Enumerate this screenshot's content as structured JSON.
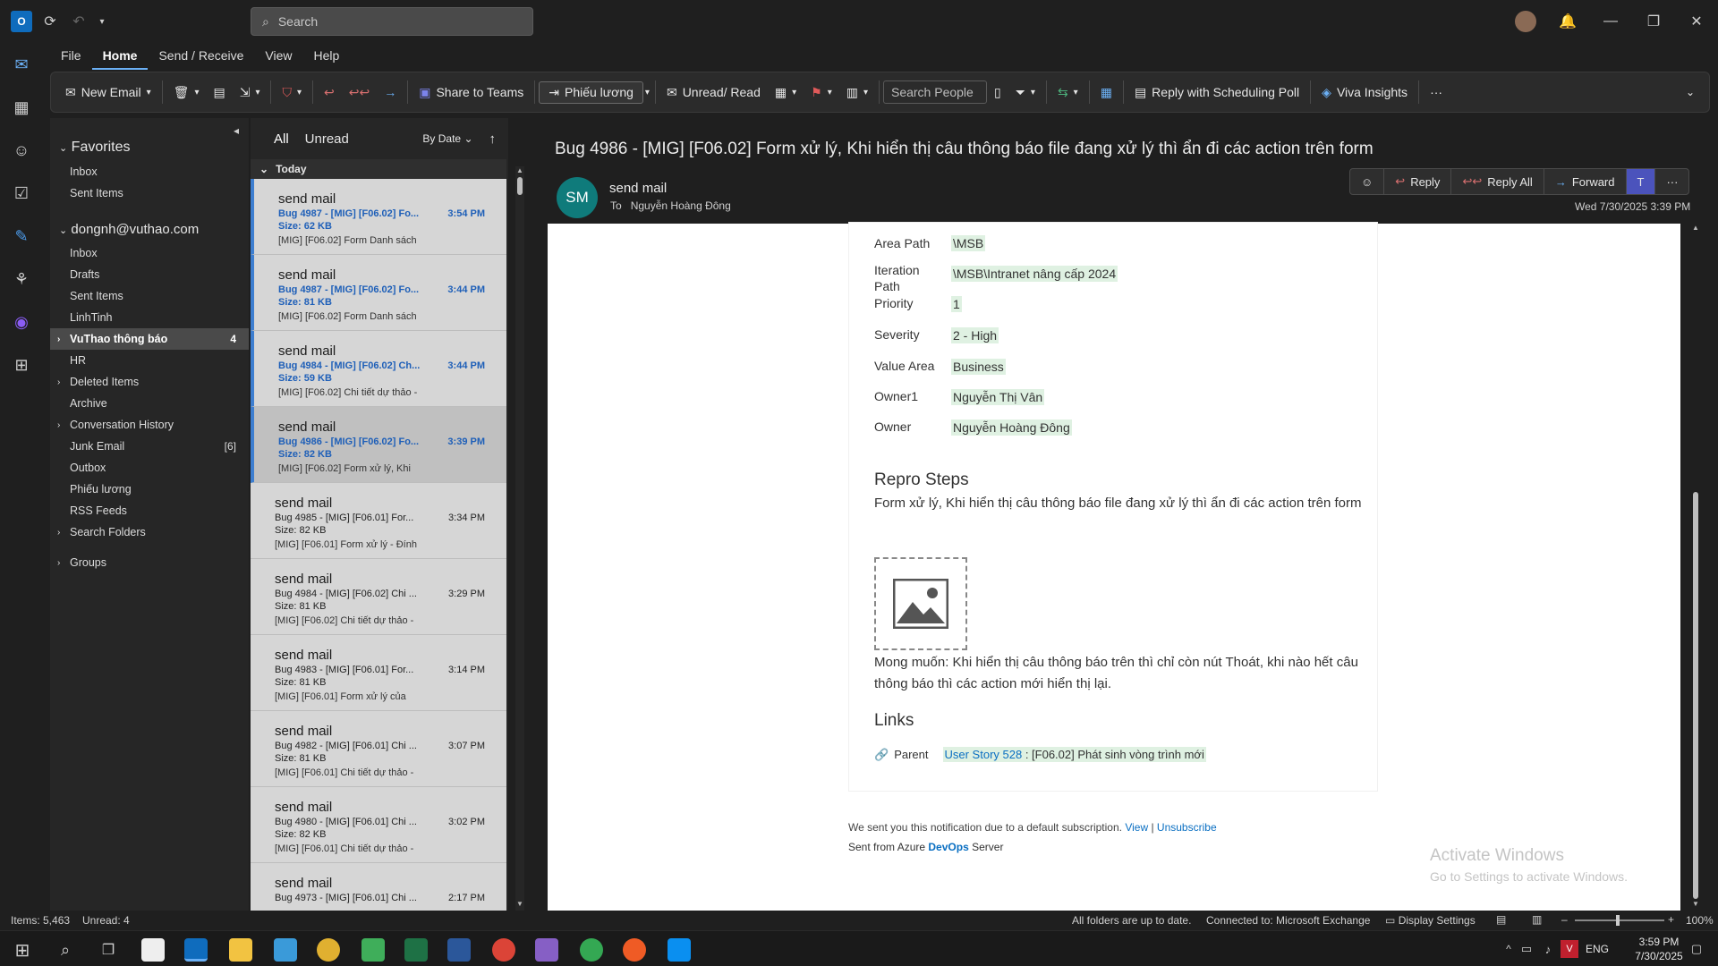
{
  "titlebar": {
    "search_placeholder": "Search"
  },
  "menubar": {
    "items": [
      "File",
      "Home",
      "Send / Receive",
      "View",
      "Help"
    ]
  },
  "ribbon": {
    "new_email": "New Email",
    "share_teams": "Share to Teams",
    "quick_step": "Phiếu lương",
    "unread_read": "Unread/ Read",
    "search_people": "Search People",
    "reply_poll": "Reply with Scheduling Poll",
    "viva": "Viva Insights"
  },
  "folders": {
    "favorites_header": "Favorites",
    "favorites": [
      "Inbox",
      "Sent Items"
    ],
    "account": "dongnh@vuthao.com",
    "items": [
      {
        "label": "Inbox",
        "count": ""
      },
      {
        "label": "Drafts",
        "count": ""
      },
      {
        "label": "Sent Items",
        "count": ""
      },
      {
        "label": "LinhTinh",
        "count": ""
      },
      {
        "label": "VuThao thông báo",
        "count": "4"
      },
      {
        "label": "HR",
        "count": ""
      },
      {
        "label": "Deleted Items",
        "count": ""
      },
      {
        "label": "Archive",
        "count": ""
      },
      {
        "label": "Conversation History",
        "count": ""
      },
      {
        "label": "Junk Email",
        "count": "[6]"
      },
      {
        "label": "Outbox",
        "count": ""
      },
      {
        "label": "Phiếu lương",
        "count": ""
      },
      {
        "label": "RSS Feeds",
        "count": ""
      },
      {
        "label": "Search Folders",
        "count": ""
      }
    ],
    "groups": "Groups"
  },
  "messagelist": {
    "tab_all": "All",
    "tab_unread": "Unread",
    "sort": "By Date",
    "group_today": "Today",
    "messages": [
      {
        "from": "send mail",
        "subject": "Bug 4987 - [MIG] [F06.02] Fo...",
        "size": "Size: 62 KB",
        "preview": "[MIG] [F06.02] Form Danh sách",
        "time": "3:54 PM"
      },
      {
        "from": "send mail",
        "subject": "Bug 4987 - [MIG] [F06.02] Fo...",
        "size": "Size: 81 KB",
        "preview": "[MIG] [F06.02] Form Danh sách",
        "time": "3:44 PM"
      },
      {
        "from": "send mail",
        "subject": "Bug 4984 - [MIG] [F06.02] Ch...",
        "size": "Size: 59 KB",
        "preview": "[MIG] [F06.02] Chi tiết dự thảo -",
        "time": "3:44 PM"
      },
      {
        "from": "send mail",
        "subject": "Bug 4986 - [MIG] [F06.02] Fo...",
        "size": "Size: 82 KB",
        "preview": "[MIG] [F06.02] Form xử lý, Khi",
        "time": "3:39 PM"
      },
      {
        "from": "send mail",
        "subject": "Bug 4985 - [MIG] [F06.01] For...",
        "size": "Size: 82 KB",
        "preview": "[MIG] [F06.01] Form xử lý - Đính",
        "time": "3:34 PM"
      },
      {
        "from": "send mail",
        "subject": "Bug 4984 - [MIG] [F06.02] Chi ...",
        "size": "Size: 81 KB",
        "preview": "[MIG] [F06.02] Chi tiết dự thảo -",
        "time": "3:29 PM"
      },
      {
        "from": "send mail",
        "subject": "Bug 4983 - [MIG] [F06.01] For...",
        "size": "Size: 81 KB",
        "preview": "[MIG] [F06.01] Form xử lý của",
        "time": "3:14 PM"
      },
      {
        "from": "send mail",
        "subject": "Bug 4982 - [MIG] [F06.01] Chi ...",
        "size": "Size: 81 KB",
        "preview": "[MIG] [F06.01] Chi tiết dự thảo -",
        "time": "3:07 PM"
      },
      {
        "from": "send mail",
        "subject": "Bug 4980 - [MIG] [F06.01] Chi ...",
        "size": "Size: 82 KB",
        "preview": "[MIG] [F06.01] Chi tiết dự thảo -",
        "time": "3:02 PM"
      },
      {
        "from": "send mail",
        "subject": "Bug 4973 - [MIG] [F06.01] Chi ...",
        "size": "",
        "preview": "",
        "time": "2:17 PM"
      }
    ]
  },
  "reading": {
    "subject": "Bug 4986 - [MIG] [F06.02] Form xử lý, Khi hiển thị câu thông báo file đang xử lý thì ẩn đi các action trên form",
    "avatar": "SM",
    "sender": "send mail",
    "to_label": "To",
    "to": "Nguyễn Hoàng Đông",
    "date": "Wed 7/30/2025 3:39 PM",
    "reply": "Reply",
    "reply_all": "Reply All",
    "forward": "Forward"
  },
  "body": {
    "fields": [
      {
        "label": "Area Path",
        "value": "\\MSB"
      },
      {
        "label": "Iteration Path",
        "value": "\\MSB\\Intranet nâng cấp 2024"
      },
      {
        "label": "Priority",
        "value": "1"
      },
      {
        "label": "Severity",
        "value": "2 - High"
      },
      {
        "label": "Value Area",
        "value": "Business"
      },
      {
        "label": "Owner1",
        "value": "Nguyễn Thị Vân"
      },
      {
        "label": "Owner",
        "value": "Nguyễn Hoàng Đông"
      }
    ],
    "repro_title": "Repro Steps",
    "repro_text": "Form xử lý, Khi hiển thị câu thông báo file đang xử lý thì ẩn đi các action trên form",
    "expect_text": "Mong muốn: Khi hiển thị câu thông báo trên thì chỉ còn nút Thoát, khi nào hết câu thông báo thì các action mới hiển thị lại.",
    "links_title": "Links",
    "parent_label": "Parent",
    "parent_link": "User Story 528",
    "parent_text": " : [F06.02] Phát sinh vòng trình mới",
    "footer_notice": "We sent you this notification due to a default subscription.",
    "view_link": "View",
    "pipe": "|",
    "unsubscribe": "Unsubscribe",
    "sent_from": "Sent from Azure",
    "devops": "DevOps",
    "server": "Server",
    "activate_title": "Activate Windows",
    "activate_sub": "Go to Settings to activate Windows."
  },
  "status": {
    "items": "Items: 5,463",
    "unread": "Unread: 4",
    "sync": "All folders are up to date.",
    "connected": "Connected to: Microsoft Exchange",
    "display": "Display Settings",
    "zoom": "100%"
  },
  "taskbar": {
    "time": "3:59 PM",
    "date": "7/30/2025",
    "lang": "ENG"
  }
}
